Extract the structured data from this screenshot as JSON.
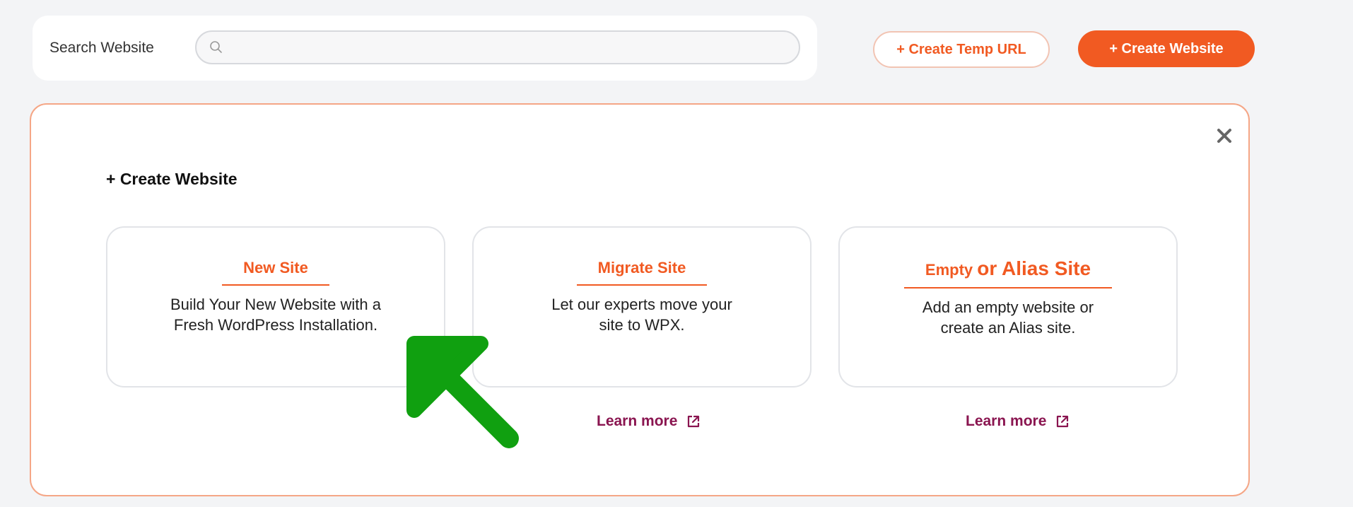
{
  "search": {
    "label": "Search Website",
    "value": "",
    "placeholder": ""
  },
  "toolbar": {
    "temp_url_label": "+ Create Temp URL",
    "create_website_label": "+ Create Website"
  },
  "panel": {
    "title": "+ Create Website",
    "cards": [
      {
        "title": "New Site",
        "description": "Build Your New Website with a Fresh WordPress Installation."
      },
      {
        "title": "Migrate Site",
        "description": "Let our experts move your site to WPX.",
        "learn_more": "Learn more"
      },
      {
        "title_part1": "Empty",
        "title_part2": "or Alias Site",
        "description": "Add an empty website or create an Alias site.",
        "learn_more": "Learn more"
      }
    ]
  },
  "icons": {
    "search": "search-icon",
    "close": "close-icon",
    "external_link": "external-link-icon",
    "pointer": "green-arrow-pointer"
  },
  "colors": {
    "accent": "#f15a22",
    "panel_border": "#f5a686",
    "link": "#8a1550",
    "arrow": "#1aa31a"
  }
}
